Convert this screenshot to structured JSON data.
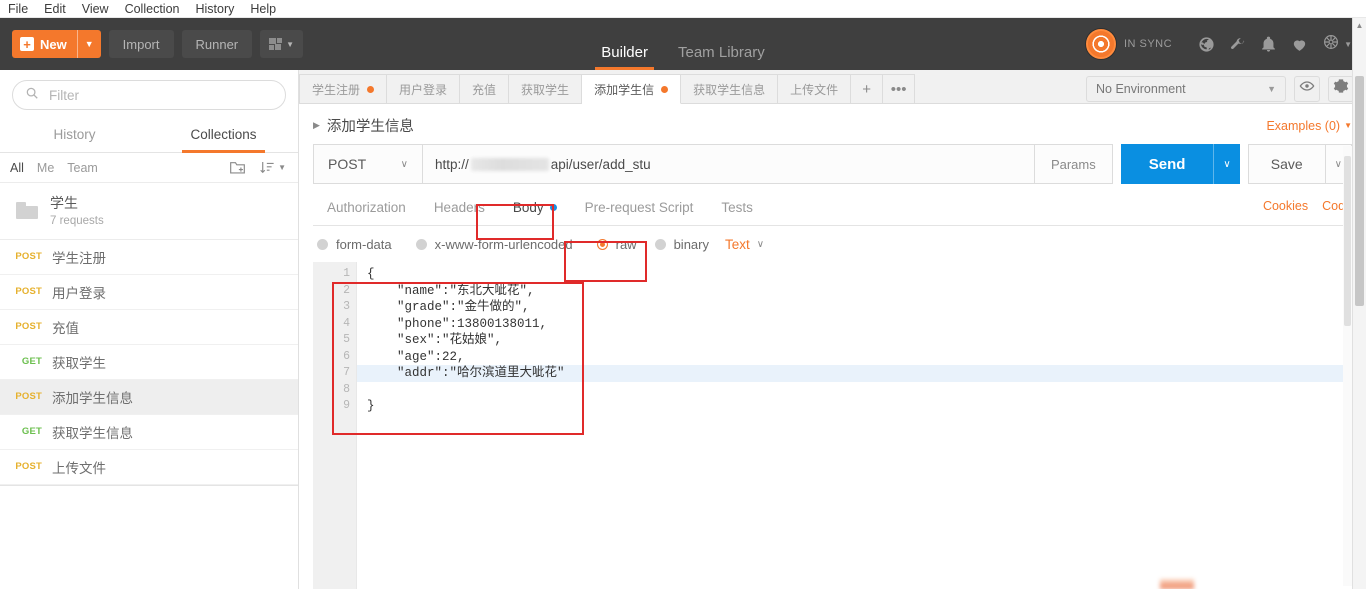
{
  "menubar": {
    "items": [
      "File",
      "Edit",
      "View",
      "Collection",
      "History",
      "Help"
    ]
  },
  "header": {
    "new_label": "New",
    "import_label": "Import",
    "runner_label": "Runner",
    "tabs": [
      {
        "label": "Builder",
        "active": true
      },
      {
        "label": "Team Library",
        "active": false
      }
    ],
    "sync_status": "IN SYNC",
    "icons": [
      "globe-icon",
      "wrench-icon",
      "bell-icon",
      "heart-icon",
      "gear-icon"
    ],
    "accent_color": "#f4782c",
    "bg_color": "#3f3f3f"
  },
  "sidebar": {
    "filter_placeholder": "Filter",
    "filter_value": "",
    "tabs": [
      {
        "label": "History",
        "active": false
      },
      {
        "label": "Collections",
        "active": true
      }
    ],
    "scopes": [
      {
        "label": "All",
        "active": true
      },
      {
        "label": "Me",
        "active": false
      },
      {
        "label": "Team",
        "active": false
      }
    ],
    "collection": {
      "name": "学生",
      "subtitle": "7 requests"
    },
    "requests": [
      {
        "method": "POST",
        "name": "学生注册",
        "selected": false
      },
      {
        "method": "POST",
        "name": "用户登录",
        "selected": false
      },
      {
        "method": "POST",
        "name": "充值",
        "selected": false
      },
      {
        "method": "GET",
        "name": "获取学生",
        "selected": false
      },
      {
        "method": "POST",
        "name": "添加学生信息",
        "selected": true
      },
      {
        "method": "GET",
        "name": "获取学生信息",
        "selected": false
      },
      {
        "method": "POST",
        "name": "上传文件",
        "selected": false
      }
    ]
  },
  "request_tabs": {
    "items": [
      {
        "label": "学生注册",
        "dirty": true,
        "active": false
      },
      {
        "label": "用户登录",
        "dirty": false,
        "active": false
      },
      {
        "label": "充值",
        "dirty": false,
        "active": false
      },
      {
        "label": "获取学生",
        "dirty": false,
        "active": false
      },
      {
        "label": "添加学生信",
        "dirty": true,
        "active": true
      },
      {
        "label": "获取学生信息",
        "dirty": false,
        "active": false
      },
      {
        "label": "上传文件",
        "dirty": false,
        "active": false
      }
    ],
    "add_label": "+",
    "more_label": "•••"
  },
  "environment": {
    "selected": "No Environment",
    "eye_icon": "eye-icon",
    "gear_icon": "gear-icon"
  },
  "request": {
    "title": "添加学生信息",
    "examples_label": "Examples (0)",
    "method": "POST",
    "url_prefix": "http://",
    "url_suffix": "api/user/add_stu",
    "params_label": "Params",
    "send_label": "Send",
    "save_label": "Save",
    "subtabs": [
      {
        "label": "Authorization",
        "active": false,
        "dot": false
      },
      {
        "label": "Headers",
        "active": false,
        "dot": false
      },
      {
        "label": "Body",
        "active": true,
        "dot": true
      },
      {
        "label": "Pre-request Script",
        "active": false,
        "dot": false
      },
      {
        "label": "Tests",
        "active": false,
        "dot": false
      }
    ],
    "cookies_label": "Cookies",
    "code_label": "Code",
    "body_types": [
      {
        "label": "form-data",
        "selected": false
      },
      {
        "label": "x-www-form-urlencoded",
        "selected": false
      },
      {
        "label": "raw",
        "selected": true
      },
      {
        "label": "binary",
        "selected": false
      }
    ],
    "raw_format": "Text"
  },
  "editor": {
    "line_numbers": [
      "1",
      "2",
      "3",
      "4",
      "5",
      "6",
      "7",
      "8",
      "9"
    ],
    "lines": [
      {
        "text": "{",
        "highlighted": false
      },
      {
        "text": "    \"name\":\"东北大呲花\",",
        "highlighted": false
      },
      {
        "text": "    \"grade\":\"金牛做的\",",
        "highlighted": false
      },
      {
        "text": "    \"phone\":13800138011,",
        "highlighted": false
      },
      {
        "text": "    \"sex\":\"花姑娘\",",
        "highlighted": false
      },
      {
        "text": "    \"age\":22,",
        "highlighted": false
      },
      {
        "text": "    \"addr\":\"哈尔滨道里大呲花\"",
        "highlighted": true
      },
      {
        "text": "",
        "highlighted": false
      },
      {
        "text": "}",
        "highlighted": false
      }
    ]
  },
  "annotations": {
    "color": "#e02a2a",
    "boxes": [
      "body-tab-highlight",
      "raw-radio-highlight",
      "raw-body-editor-highlight"
    ]
  }
}
